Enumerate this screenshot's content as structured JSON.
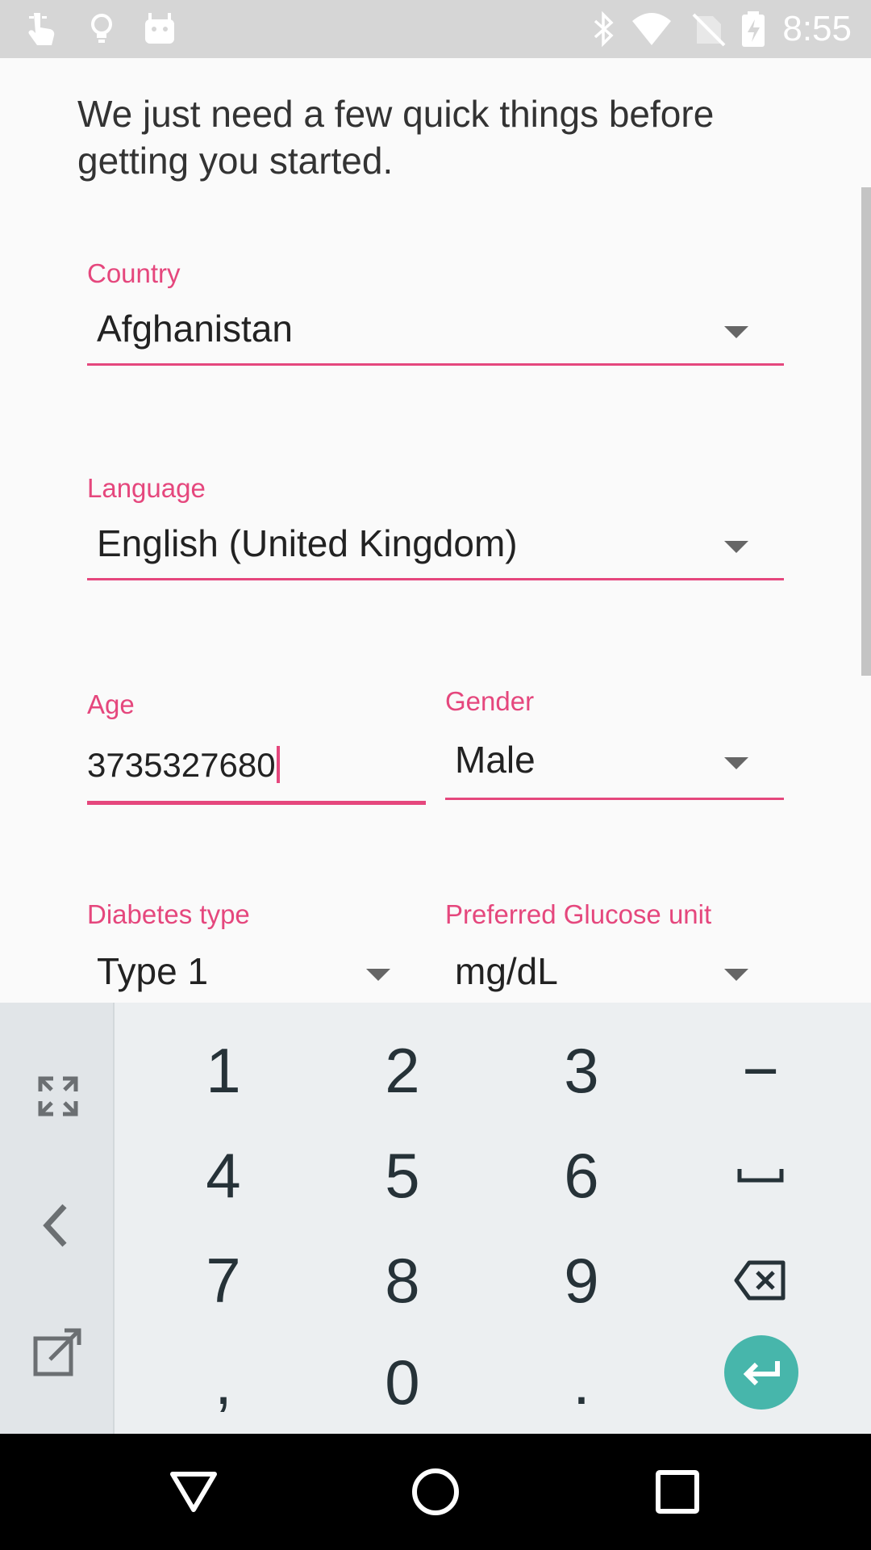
{
  "status_bar": {
    "time": "8:55",
    "icons_left": [
      "touch-icon",
      "lightbulb-icon",
      "android-icon"
    ],
    "icons_right": [
      "bluetooth-icon",
      "wifi-icon",
      "no-sim-icon",
      "battery-icon"
    ]
  },
  "form": {
    "intro": "We just need a few quick things before getting you started.",
    "country": {
      "label": "Country",
      "value": "Afghanistan"
    },
    "language": {
      "label": "Language",
      "value": "English (United Kingdom)"
    },
    "age": {
      "label": "Age",
      "value": "3735327680"
    },
    "gender": {
      "label": "Gender",
      "value": "Male"
    },
    "diabetes_type": {
      "label": "Diabetes type",
      "value": "Type 1"
    },
    "glucose_unit": {
      "label": "Preferred Glucose unit",
      "value": "mg/dL"
    }
  },
  "keyboard": {
    "keys": {
      "k1": "1",
      "k2": "2",
      "k3": "3",
      "minus": "−",
      "k4": "4",
      "k5": "5",
      "k6": "6",
      "k7": "7",
      "k8": "8",
      "k9": "9",
      "comma": ",",
      "k0": "0",
      "period": "."
    },
    "side_icons": [
      "expand-icon",
      "back-arrow-icon",
      "external-edit-icon"
    ],
    "accent": "#47b6ab"
  },
  "nav_bar": {
    "icons": [
      "back-triangle-icon",
      "home-circle-icon",
      "recents-square-icon"
    ]
  },
  "colors": {
    "accent": "#e5477d",
    "status_bar": "#d6d6d6",
    "keyboard_bg": "#eceff1"
  }
}
